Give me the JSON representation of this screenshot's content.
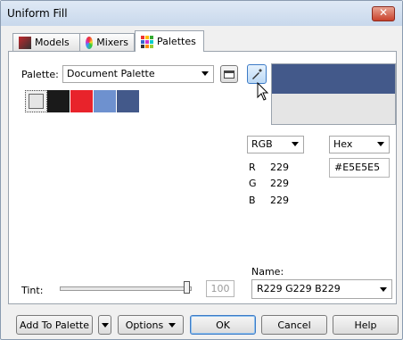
{
  "window": {
    "title": "Uniform Fill"
  },
  "tabs": [
    {
      "label": "Models",
      "icon": "models-icon"
    },
    {
      "label": "Mixers",
      "icon": "mixers-icon"
    },
    {
      "label": "Palettes",
      "icon": "palettes-icon",
      "active": true
    }
  ],
  "palette": {
    "label": "Palette:",
    "selected": "Document Palette",
    "swatches": [
      "#f0f0f0",
      "#1a1a1a",
      "#e8232b",
      "#6e91cf",
      "#43598a"
    ]
  },
  "preview": {
    "new_color": "#43598a",
    "old_color": "#e5e5e5"
  },
  "color_model": {
    "selected": "RGB",
    "format": "Hex"
  },
  "rgb": [
    {
      "channel": "R",
      "value": "229"
    },
    {
      "channel": "G",
      "value": "229"
    },
    {
      "channel": "B",
      "value": "229"
    }
  ],
  "hex_value": "#E5E5E5",
  "tint": {
    "label": "Tint:",
    "value": "100",
    "level": 1.0
  },
  "name": {
    "label": "Name:",
    "value": "R229 G229 B229"
  },
  "buttons": {
    "add_to_palette": "Add To Palette",
    "options": "Options",
    "ok": "OK",
    "cancel": "Cancel",
    "help": "Help"
  }
}
